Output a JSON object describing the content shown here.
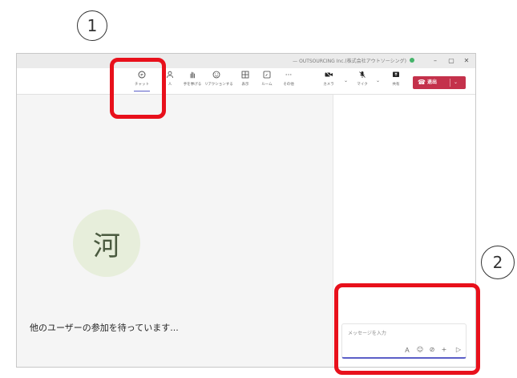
{
  "annotations": {
    "step1": "1",
    "step2": "2"
  },
  "window": {
    "title": "— OUTSOURCING Inc.(株式会社アウトソーシング)",
    "minimize": "–",
    "maximize": "▢",
    "close": "✕"
  },
  "toolbar": {
    "chat": "チャット",
    "people": "人",
    "raise_hand": "手を挙げる",
    "reactions": "リアクションする",
    "view": "表示",
    "rooms": "ルーム",
    "more": "その他",
    "camera": "カメラ",
    "mic": "マイク",
    "share": "共有",
    "leave": "退出"
  },
  "icons": {
    "chat": "chat-icon",
    "people": "people-icon",
    "raise_hand": "hand-icon",
    "reactions": "smiley-icon",
    "view": "grid-icon",
    "rooms": "rooms-icon",
    "more": "more-icon",
    "camera": "camera-off-icon",
    "mic": "mic-off-icon",
    "share": "share-icon",
    "leave": "phone-icon"
  },
  "stage": {
    "avatar_initial": "河",
    "waiting_text": "他のユーザーの参加を待っています..."
  },
  "chat": {
    "placeholder": "メッセージを入力"
  },
  "colors": {
    "accent": "#5b5fc7",
    "leave": "#c4314b",
    "callout": "#e8101b",
    "avatar_bg": "#e7eedb"
  }
}
